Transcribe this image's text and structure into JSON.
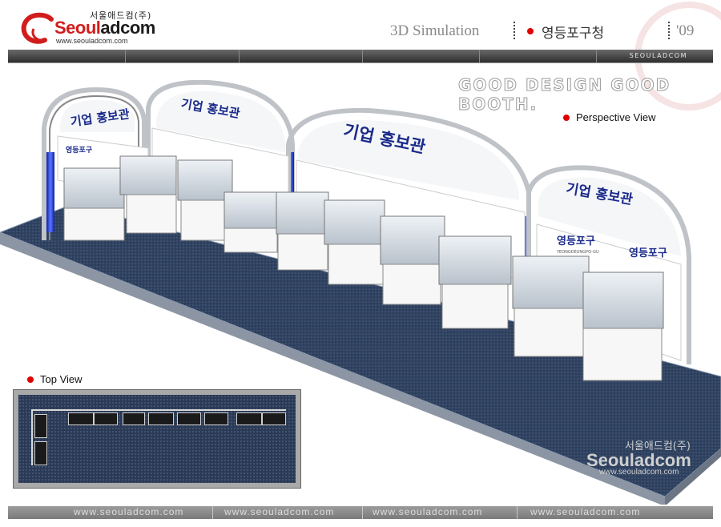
{
  "header": {
    "logo_korean": "서울애드컴(주)",
    "logo_name_red": "Seoul",
    "logo_name_dark": "adcom",
    "logo_url": "www.seouladcom.com",
    "title": "3D Simulation",
    "client": "영등포구청",
    "year": "'09",
    "bar_label": "SEOULADCOM",
    "tagline": "GOOD DESIGN GOOD BOOTH."
  },
  "views": {
    "perspective_label": "Perspective View",
    "top_label": "Top View"
  },
  "booth": {
    "arch_text": "기업 홍보관",
    "panel_text": "영등포구",
    "panel_subtext": "YEONGDEUNGPO-GU"
  },
  "watermark": {
    "korean": "서울애드컴(주)",
    "name": "Seouladcom",
    "url": "www.seouladcom.com"
  },
  "footer": {
    "urls": [
      "www.seouladcom.com",
      "www.seouladcom.com",
      "www.seouladcom.com",
      "www.seouladcom.com"
    ]
  },
  "colors": {
    "accent_red": "#e00000",
    "logo_red": "#d21c1c",
    "floor_blue": "#2f4260",
    "arch_text_blue": "#1a2a8a",
    "truss_light_blue": "#3a55ff"
  }
}
